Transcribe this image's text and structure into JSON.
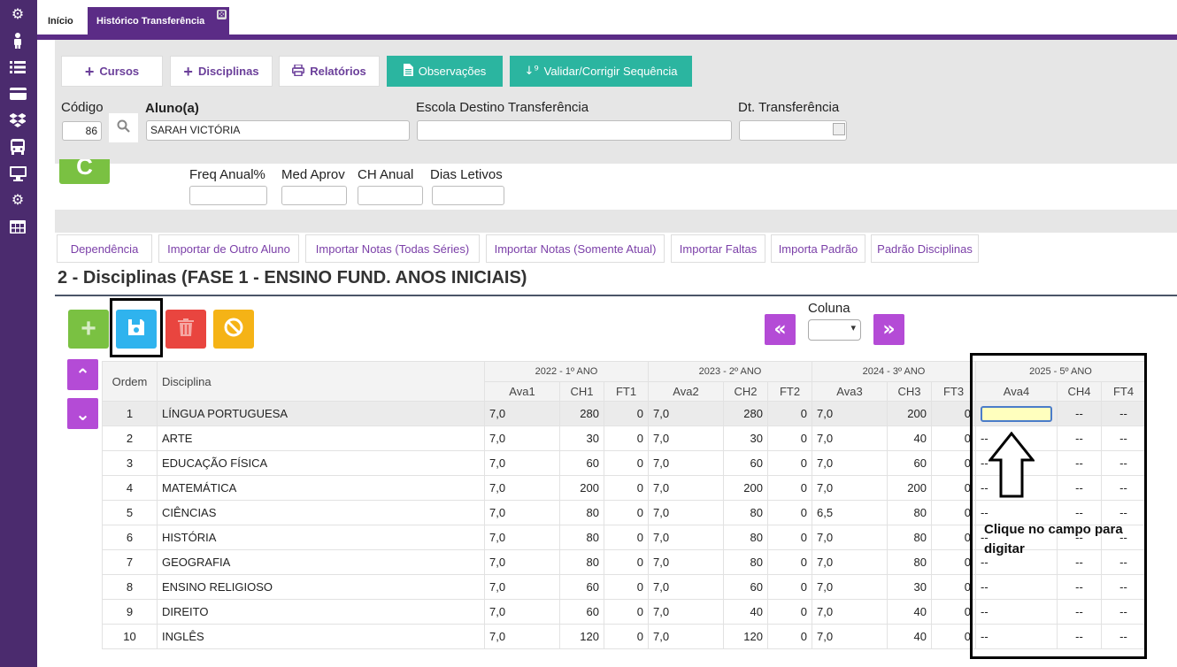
{
  "tabs": {
    "home": "Início",
    "active": "Histórico Transferência",
    "close": "⊠"
  },
  "toolbar": {
    "cursos": "Cursos",
    "disciplinas": "Disciplinas",
    "relatorios": "Relatórios",
    "observacoes": "Observações",
    "validar": "Validar/Corrigir Sequência"
  },
  "form": {
    "codigo_label": "Código",
    "codigo_value": "86",
    "aluno_label": "Aluno(a)",
    "aluno_value": "SARAH VICTÓRIA",
    "escola_label": "Escola Destino Transferência",
    "escola_value": "",
    "dt_label": "Dt. Transferência",
    "dt_value": "",
    "freq_label": "Freq Anual%",
    "med_label": "Med Aprov",
    "ch_label": "CH Anual",
    "dias_label": "Dias Letivos"
  },
  "subtabs": [
    "Dependência",
    "Importar de Outro Aluno",
    "Importar Notas (Todas Séries)",
    "Importar Notas (Somente Atual)",
    "Importar Faltas",
    "Importa Padrão",
    "Padrão Disciplinas"
  ],
  "section_title": "2 - Disciplinas (FASE 1 - ENSINO FUND. ANOS INICIAIS)",
  "coluna_label": "Coluna",
  "grid": {
    "col_ordem": "Ordem",
    "col_disciplina": "Disciplina",
    "groups": [
      "2022 - 1º ANO",
      "2023 - 2º ANO",
      "2024 - 3º ANO",
      "2025 - 5º ANO"
    ],
    "subcols": [
      [
        "Ava1",
        "CH1",
        "FT1"
      ],
      [
        "Ava2",
        "CH2",
        "FT2"
      ],
      [
        "Ava3",
        "CH3",
        "FT3"
      ],
      [
        "Ava4",
        "CH4",
        "FT4"
      ]
    ],
    "rows": [
      {
        "ordem": "1",
        "disciplina": "LÍNGUA PORTUGUESA",
        "v": [
          "7,0",
          "280",
          "0",
          "7,0",
          "280",
          "0",
          "7,0",
          "200",
          "0"
        ],
        "ava4": "",
        "ch4": "--",
        "ft4": "--"
      },
      {
        "ordem": "2",
        "disciplina": "ARTE",
        "v": [
          "7,0",
          "30",
          "0",
          "7,0",
          "30",
          "0",
          "7,0",
          "40",
          "0"
        ],
        "ava4": "--",
        "ch4": "--",
        "ft4": "--"
      },
      {
        "ordem": "3",
        "disciplina": "EDUCAÇÃO FÍSICA",
        "v": [
          "7,0",
          "60",
          "0",
          "7,0",
          "60",
          "0",
          "7,0",
          "60",
          "0"
        ],
        "ava4": "--",
        "ch4": "--",
        "ft4": "--"
      },
      {
        "ordem": "4",
        "disciplina": "MATEMÁTICA",
        "v": [
          "7,0",
          "200",
          "0",
          "7,0",
          "200",
          "0",
          "7,0",
          "200",
          "0"
        ],
        "ava4": "--",
        "ch4": "--",
        "ft4": "--"
      },
      {
        "ordem": "5",
        "disciplina": "CIÊNCIAS",
        "v": [
          "7,0",
          "80",
          "0",
          "7,0",
          "80",
          "0",
          "6,5",
          "80",
          "0"
        ],
        "ava4": "--",
        "ch4": "--",
        "ft4": "--"
      },
      {
        "ordem": "6",
        "disciplina": "HISTÓRIA",
        "v": [
          "7,0",
          "80",
          "0",
          "7,0",
          "80",
          "0",
          "7,0",
          "80",
          "0"
        ],
        "ava4": "--",
        "ch4": "--",
        "ft4": "--"
      },
      {
        "ordem": "7",
        "disciplina": "GEOGRAFIA",
        "v": [
          "7,0",
          "80",
          "0",
          "7,0",
          "80",
          "0",
          "7,0",
          "80",
          "0"
        ],
        "ava4": "--",
        "ch4": "--",
        "ft4": "--"
      },
      {
        "ordem": "8",
        "disciplina": "ENSINO RELIGIOSO",
        "v": [
          "7,0",
          "60",
          "0",
          "7,0",
          "60",
          "0",
          "7,0",
          "30",
          "0"
        ],
        "ava4": "--",
        "ch4": "--",
        "ft4": "--"
      },
      {
        "ordem": "9",
        "disciplina": "DIREITO",
        "v": [
          "7,0",
          "60",
          "0",
          "7,0",
          "40",
          "0",
          "7,0",
          "40",
          "0"
        ],
        "ava4": "--",
        "ch4": "--",
        "ft4": "--"
      },
      {
        "ordem": "10",
        "disciplina": "INGLÊS",
        "v": [
          "7,0",
          "120",
          "0",
          "7,0",
          "120",
          "0",
          "7,0",
          "40",
          "0"
        ],
        "ava4": "--",
        "ch4": "--",
        "ft4": "--"
      }
    ]
  },
  "annotation": {
    "hint": "Clique no campo para digitar"
  },
  "sidebar_icons": [
    "gears-icon",
    "person-icon",
    "list-icon",
    "card-icon",
    "dropbox-icon",
    "bus-icon",
    "monitor-icon",
    "gear-icon",
    "table-icon"
  ],
  "colors": {
    "sidebar": "#4b2b6e",
    "accent": "#5b2c86",
    "teal": "#2bb5a0",
    "purple_btn": "#b44bd6"
  }
}
